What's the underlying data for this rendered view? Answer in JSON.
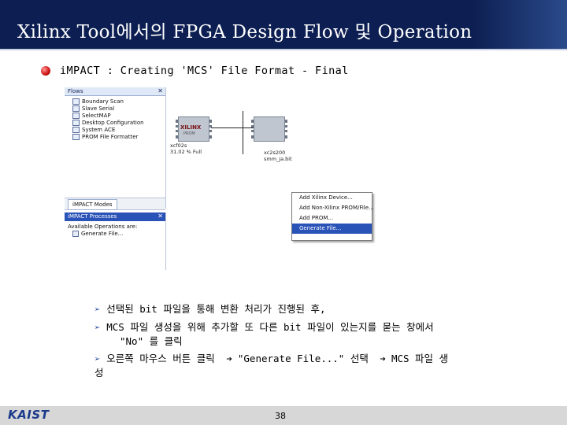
{
  "slide": {
    "title": "Xilinx Tool에서의 FPGA Design Flow 및 Operation",
    "bullet": "iMPACT : Creating  'MCS'  File Format - Final",
    "page_number": "38",
    "footer_logo": "KAIST"
  },
  "screenshot": {
    "flows_panel": {
      "title": "Flows",
      "items": [
        {
          "label": "Boundary Scan",
          "icon": "chain-icon"
        },
        {
          "label": "Slave Serial",
          "icon": "serial-icon"
        },
        {
          "label": "SelectMAP",
          "icon": "map-icon"
        },
        {
          "label": "Desktop Configuration",
          "icon": "config-icon"
        },
        {
          "label": "System ACE",
          "icon": "ace-icon"
        },
        {
          "label": "PROM File Formatter",
          "icon": "prom-icon"
        }
      ],
      "tab": "iMPACT Modes"
    },
    "processes_panel": {
      "title": "iMPACT Processes",
      "header_text": "Available Operations are:",
      "items": [
        "Generate File..."
      ]
    },
    "canvas": {
      "device1": {
        "chip_text": "XILINX",
        "chip_sub": "PROM",
        "label_line1": "xcf02s",
        "label_line2": "31.02 % Full"
      },
      "device2": {
        "label_line1": "xc2s200",
        "label_line2": "smm_ja.bit"
      }
    },
    "context_menu": {
      "items": [
        {
          "label": "Add Xilinx Device...",
          "selected": false
        },
        {
          "label": "Add Non-Xilinx PROM/File...",
          "selected": false
        },
        {
          "label": "Add PROM...",
          "selected": false
        },
        {
          "label": "Generate File...",
          "selected": true
        }
      ]
    }
  },
  "notes": {
    "line1": "선택된 bit 파일을 통해 변환 처리가 진행된 후,",
    "line2": "MCS 파일 생성을 위해 추가할 또 다른 bit 파일이 있는지를 묻는 창에서",
    "line3": "\"No\" 를 클릭",
    "line4_a": "오른쪽 마우스 버튼 클릭",
    "line4_b": "\"Generate File...\" 선택",
    "line4_c": "MCS 파일 생",
    "line5": "성"
  },
  "colors": {
    "title_bg": "#0d1f52",
    "selection": "#2a53b8",
    "footer_bg": "#d7d7d7",
    "bullet": "#d11818"
  }
}
